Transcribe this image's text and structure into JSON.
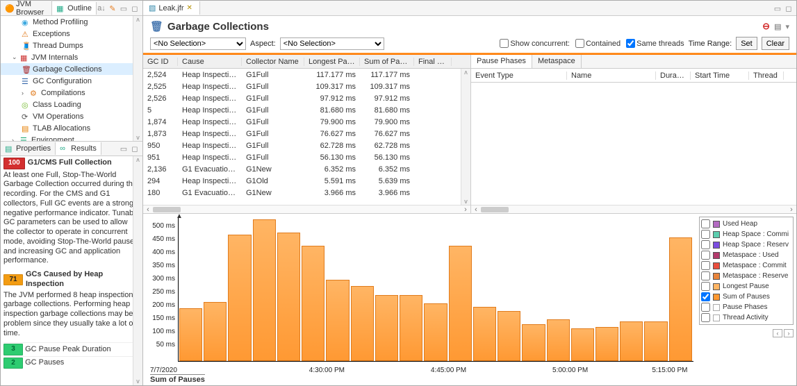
{
  "left_tabs": {
    "jvm_browser": "JVM Browser",
    "outline": "Outline"
  },
  "tree": {
    "method_profiling": "Method Profiling",
    "exceptions": "Exceptions",
    "thread_dumps": "Thread Dumps",
    "jvm_internals": "JVM Internals",
    "garbage_collections": "Garbage Collections",
    "gc_configuration": "GC Configuration",
    "compilations": "Compilations",
    "class_loading": "Class Loading",
    "vm_operations": "VM Operations",
    "tlab_allocations": "TLAB Allocations",
    "environment": "Environment"
  },
  "prop_tabs": {
    "properties": "Properties",
    "results": "Results"
  },
  "results": {
    "r1": {
      "badge": "100",
      "title": "G1/CMS Full Collection",
      "body": "At least one Full, Stop-The-World Garbage Collection occurred during this recording. For the CMS and G1 collectors, Full GC events are a strong negative performance indicator. Tunable GC parameters can be used to allow the collector to operate in concurrent mode, avoiding Stop-The-World pauses and increasing GC and application performance."
    },
    "r2": {
      "badge": "71",
      "title": "GCs Caused by Heap Inspection",
      "body": "The JVM performed 8 heap inspection garbage collections. Performing heap inspection garbage collections may be a problem since they usually take a lot of time."
    },
    "r3": {
      "badge": "3",
      "title": "GC Pause Peak Duration"
    },
    "r4": {
      "badge": "2",
      "title": "GC Pauses"
    }
  },
  "editor_tab": {
    "name": "Leak.jfr"
  },
  "page": {
    "title": "Garbage Collections"
  },
  "toolbar": {
    "no_selection": "<No Selection>",
    "aspect": "Aspect:",
    "show_concurrent": "Show concurrent:",
    "contained": "Contained",
    "same_threads": "Same threads",
    "time_range": "Time Range:",
    "set": "Set",
    "clear": "Clear"
  },
  "grid_headers": {
    "gcid": "GC ID",
    "cause": "Cause",
    "collector": "Collector Name",
    "longest": "Longest Pau...",
    "sum": "Sum of Pauses",
    "final": "Final Refe"
  },
  "grid_rows": [
    {
      "id": "2,524",
      "cause": "Heap Inspectio...",
      "coll": "G1Full",
      "lp": "117.177 ms",
      "sp": "117.177 ms"
    },
    {
      "id": "2,525",
      "cause": "Heap Inspectio...",
      "coll": "G1Full",
      "lp": "109.317 ms",
      "sp": "109.317 ms"
    },
    {
      "id": "2,526",
      "cause": "Heap Inspectio...",
      "coll": "G1Full",
      "lp": "97.912 ms",
      "sp": "97.912 ms"
    },
    {
      "id": "5",
      "cause": "Heap Inspectio...",
      "coll": "G1Full",
      "lp": "81.680 ms",
      "sp": "81.680 ms"
    },
    {
      "id": "1,874",
      "cause": "Heap Inspectio...",
      "coll": "G1Full",
      "lp": "79.900 ms",
      "sp": "79.900 ms"
    },
    {
      "id": "1,873",
      "cause": "Heap Inspectio...",
      "coll": "G1Full",
      "lp": "76.627 ms",
      "sp": "76.627 ms"
    },
    {
      "id": "950",
      "cause": "Heap Inspectio...",
      "coll": "G1Full",
      "lp": "62.728 ms",
      "sp": "62.728 ms"
    },
    {
      "id": "951",
      "cause": "Heap Inspectio...",
      "coll": "G1Full",
      "lp": "56.130 ms",
      "sp": "56.130 ms"
    },
    {
      "id": "2,136",
      "cause": "G1 Evacuation ...",
      "coll": "G1New",
      "lp": "6.352 ms",
      "sp": "6.352 ms"
    },
    {
      "id": "294",
      "cause": "Heap Inspectio...",
      "coll": "G1Old",
      "lp": "5.591 ms",
      "sp": "5.639 ms"
    },
    {
      "id": "180",
      "cause": "G1 Evacuation ...",
      "coll": "G1New",
      "lp": "3.966 ms",
      "sp": "3.966 ms"
    }
  ],
  "sub_tabs": {
    "pause_phases": "Pause Phases",
    "metaspace": "Metaspace"
  },
  "sub_headers": {
    "event_type": "Event Type",
    "name": "Name",
    "duration": "Duration",
    "start_time": "Start Time",
    "thread": "Thread"
  },
  "legend": {
    "used_heap": "Used Heap",
    "heap_commit": "Heap Space : Commi",
    "heap_reserve": "Heap Space : Reserv",
    "meta_used": "Metaspace : Used",
    "meta_commit": "Metaspace : Commit",
    "meta_reserve": "Metaspace : Reserve",
    "longest_pause": "Longest Pause",
    "sum_pauses": "Sum of Pauses",
    "pause_phases": "Pause Phases",
    "thread_activity": "Thread Activity"
  },
  "chart_data": {
    "type": "bar",
    "title": "Sum of Pauses",
    "ylabel": "ms",
    "ylim": [
      0,
      550
    ],
    "yticks": [
      "50 ms",
      "100 ms",
      "150 ms",
      "200 ms",
      "250 ms",
      "300 ms",
      "350 ms",
      "400 ms",
      "450 ms",
      "500 ms"
    ],
    "x_date": "7/7/2020",
    "x_ticks": [
      "4:30:00 PM",
      "4:45:00 PM",
      "5:00:00 PM",
      "5:15:00 PM"
    ],
    "values": [
      200,
      225,
      480,
      540,
      490,
      440,
      310,
      285,
      250,
      250,
      220,
      440,
      205,
      190,
      140,
      160,
      125,
      130,
      150,
      150,
      470
    ]
  }
}
